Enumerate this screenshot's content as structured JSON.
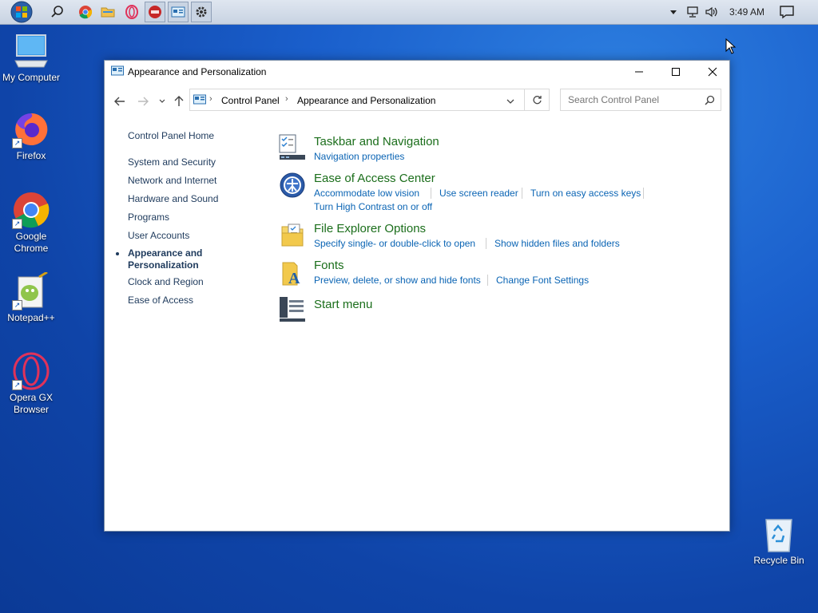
{
  "taskbar": {
    "clock": "3:49 AM"
  },
  "desktop": {
    "icons": [
      {
        "label": "My Computer"
      },
      {
        "label": "Firefox"
      },
      {
        "label": "Google Chrome"
      },
      {
        "label": "Notepad++"
      },
      {
        "label": "Opera GX Browser"
      },
      {
        "label": "Recycle Bin"
      }
    ]
  },
  "window": {
    "title": "Appearance and Personalization",
    "address": {
      "crumbs": [
        "Control Panel",
        "Appearance and Personalization"
      ]
    },
    "search": {
      "placeholder": "Search Control Panel"
    },
    "leftnav": [
      "Control Panel Home",
      "System and Security",
      "Network and Internet",
      "Hardware and Sound",
      "Programs",
      "User Accounts",
      "Appearance and Personalization",
      "Clock and Region",
      "Ease of Access"
    ],
    "categories": [
      {
        "title": "Taskbar and Navigation",
        "links": [
          "Navigation properties"
        ]
      },
      {
        "title": "Ease of Access Center",
        "links": [
          "Accommodate low vision",
          "Use screen reader",
          "Turn on easy access keys",
          "Turn High Contrast on or off"
        ]
      },
      {
        "title": "File Explorer Options",
        "links": [
          "Specify single- or double-click to open",
          "Show hidden files and folders"
        ]
      },
      {
        "title": "Fonts",
        "links": [
          "Preview, delete, or show and hide fonts",
          "Change Font Settings"
        ]
      },
      {
        "title": "Start menu",
        "links": []
      }
    ]
  }
}
